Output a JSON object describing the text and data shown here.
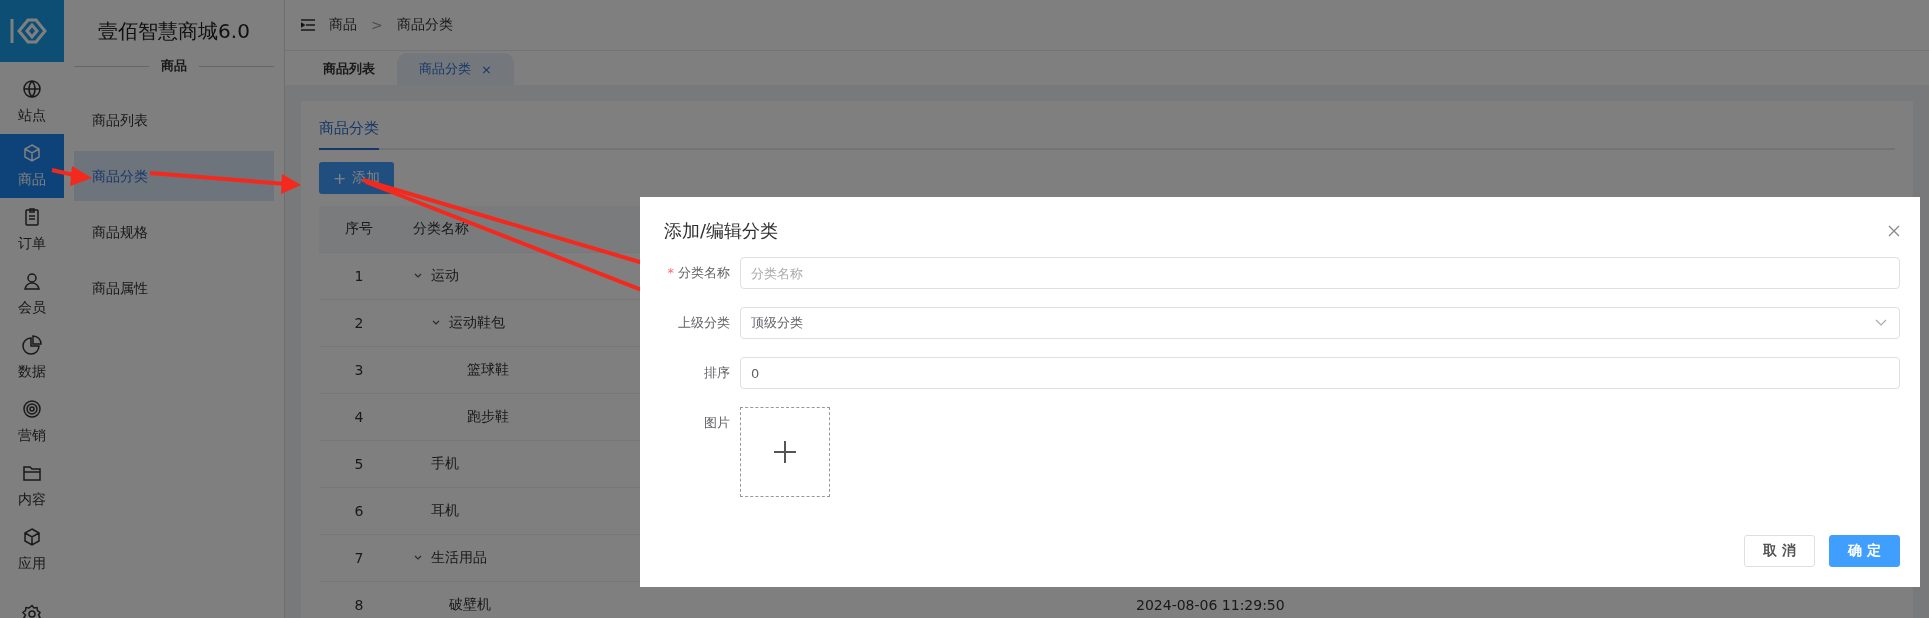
{
  "rail": {
    "items": [
      {
        "label": "站点",
        "selected": false
      },
      {
        "label": "商品",
        "selected": true
      },
      {
        "label": "订单",
        "selected": false
      },
      {
        "label": "会员",
        "selected": false
      },
      {
        "label": "数据",
        "selected": false
      },
      {
        "label": "营销",
        "selected": false
      },
      {
        "label": "内容",
        "selected": false
      },
      {
        "label": "应用",
        "selected": false
      },
      {
        "selected": false
      }
    ]
  },
  "sidebar": {
    "title": "壹佰智慧商城6.0",
    "section": "商品",
    "items": [
      {
        "label": "商品列表",
        "selected": false
      },
      {
        "label": "商品分类",
        "selected": true
      },
      {
        "label": "商品规格",
        "selected": false
      },
      {
        "label": "商品属性",
        "selected": false
      }
    ]
  },
  "breadcrumb": [
    "商品",
    "商品分类"
  ],
  "breadcrumb_separator": ">",
  "tabs": [
    {
      "label": "商品列表",
      "selected": false,
      "closable": false
    },
    {
      "label": "商品分类",
      "selected": true,
      "closable": true
    }
  ],
  "close_glyph": "×",
  "content_tabs": [
    {
      "label": "商品分类",
      "selected": true
    }
  ],
  "add_button": {
    "icon": "+",
    "label": "添加"
  },
  "table": {
    "columns": [
      "序号",
      "分类名称"
    ],
    "rows": [
      {
        "index": "1",
        "name": "运动",
        "expanded": true,
        "children": [
          {
            "index": "2",
            "name": "运动鞋包",
            "expanded": true,
            "children": [
              {
                "index": "3",
                "name": "篮球鞋"
              },
              {
                "index": "4",
                "name": "跑步鞋"
              }
            ]
          }
        ]
      },
      {
        "index": "5",
        "name": "手机"
      },
      {
        "index": "6",
        "name": "耳机"
      },
      {
        "index": "7",
        "name": "生活用品",
        "expanded": true,
        "children": [
          {
            "index": "8",
            "name": "破壁机",
            "column_3": "2024-08-06 11:29:50"
          }
        ]
      }
    ]
  },
  "dialog": {
    "title": "添加/编辑分类",
    "fields": [
      {
        "kind": "input",
        "label": "分类名称",
        "required": true,
        "placeholder": "分类名称"
      },
      {
        "kind": "select",
        "label": "上级分类",
        "required": false,
        "value": "顶级分类"
      },
      {
        "kind": "input",
        "label": "排序",
        "required": false,
        "value": "0"
      },
      {
        "kind": "upload",
        "label": "图片",
        "required": false
      }
    ],
    "required_mark": "*",
    "buttons": [
      {
        "label": "取 消",
        "primary": false
      },
      {
        "label": "确 定",
        "primary": true
      }
    ]
  }
}
